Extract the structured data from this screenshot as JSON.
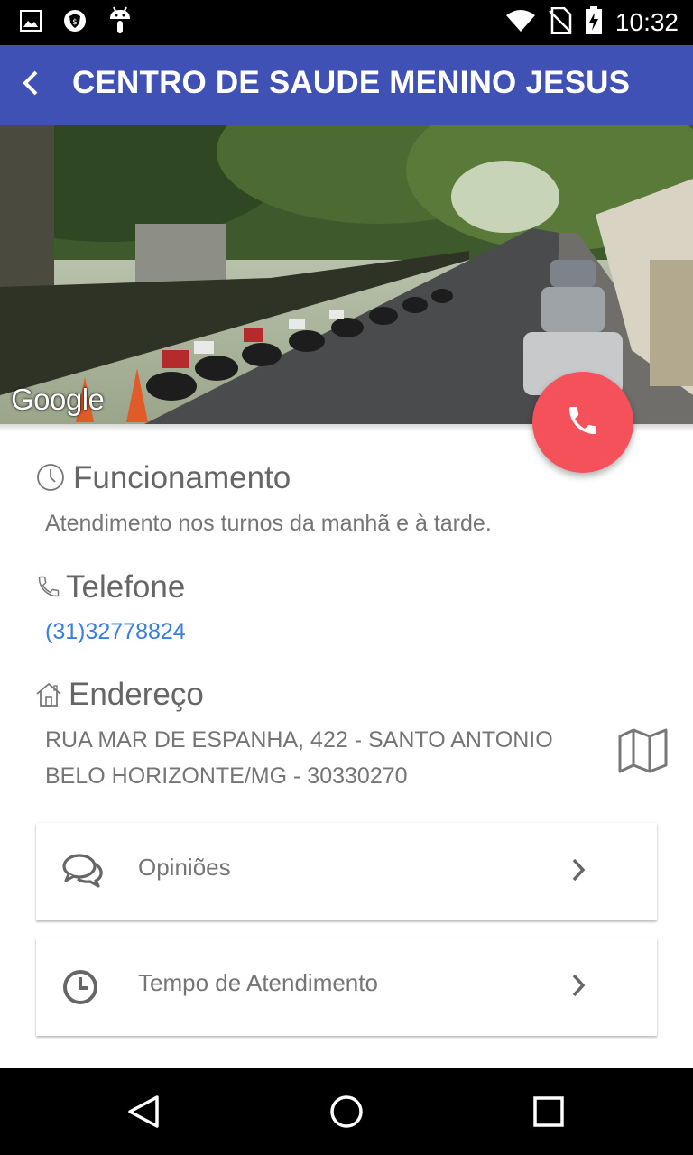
{
  "status_bar": {
    "time": "10:32",
    "icons": [
      "image-notification-icon",
      "shield-notification-icon",
      "android-notification-icon",
      "wifi-icon",
      "no-sim-icon",
      "battery-charging-icon"
    ]
  },
  "app_bar": {
    "title": "CENTRO DE SAUDE MENINO JESUS",
    "back_icon": "back-arrow-icon"
  },
  "street_view": {
    "watermark": "Google"
  },
  "fab": {
    "icon": "phone-icon",
    "color": "#f4515a"
  },
  "hours": {
    "title": "Funcionamento",
    "text": "Atendimento nos turnos da manhã e à tarde."
  },
  "phone": {
    "title": "Telefone",
    "number": "(31)32778824"
  },
  "address": {
    "title": "Endereço",
    "line1": "RUA MAR DE ESPANHA, 422 - SANTO ANTONIO",
    "line2": "BELO HORIZONTE/MG - 30330270",
    "map_icon": "map-icon"
  },
  "cards": [
    {
      "label": "Opiniões",
      "icon": "chat-bubbles-icon"
    },
    {
      "label": "Tempo de Atendimento",
      "icon": "clock-icon"
    }
  ],
  "colors": {
    "primary": "#3f51b5",
    "accent": "#f4515a",
    "link": "#3a7ee3",
    "text_secondary": "#757575"
  }
}
